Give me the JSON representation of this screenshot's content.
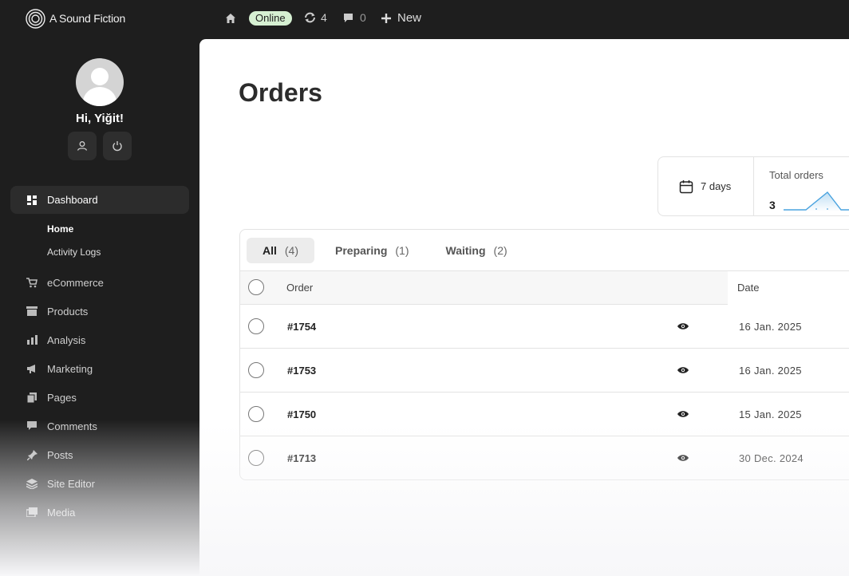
{
  "topbar": {
    "site_name": "A Sound Fiction",
    "status_badge": "Online",
    "updates_count": "4",
    "comments_count": "0",
    "new_label": "New"
  },
  "sidebar": {
    "greeting": "Hi, Yiğit!",
    "nav": {
      "dashboard": "Dashboard",
      "sub_home": "Home",
      "sub_activity": "Activity Logs",
      "ecommerce": "eCommerce",
      "products": "Products",
      "analysis": "Analysis",
      "marketing": "Marketing",
      "pages": "Pages",
      "comments": "Comments",
      "posts": "Posts",
      "site_editor": "Site Editor",
      "media": "Media"
    }
  },
  "main": {
    "title": "Orders",
    "stats": {
      "period": "7 days",
      "total_label": "Total orders",
      "total_value": "3"
    },
    "tabs": [
      {
        "label": "All",
        "count": "(4)"
      },
      {
        "label": "Preparing",
        "count": "(1)"
      },
      {
        "label": "Waiting",
        "count": "(2)"
      }
    ],
    "columns": {
      "order": "Order",
      "date": "Date"
    },
    "rows": [
      {
        "id": "#1754",
        "date": "16 Jan. 2025"
      },
      {
        "id": "#1753",
        "date": "16 Jan. 2025"
      },
      {
        "id": "#1750",
        "date": "15 Jan. 2025"
      },
      {
        "id": "#1713",
        "date": "30 Dec. 2024"
      }
    ]
  },
  "colors": {
    "dark_bg": "#1e1e1e",
    "online_badge": "#d6f0d2",
    "sparkline": "#4aa3df"
  }
}
